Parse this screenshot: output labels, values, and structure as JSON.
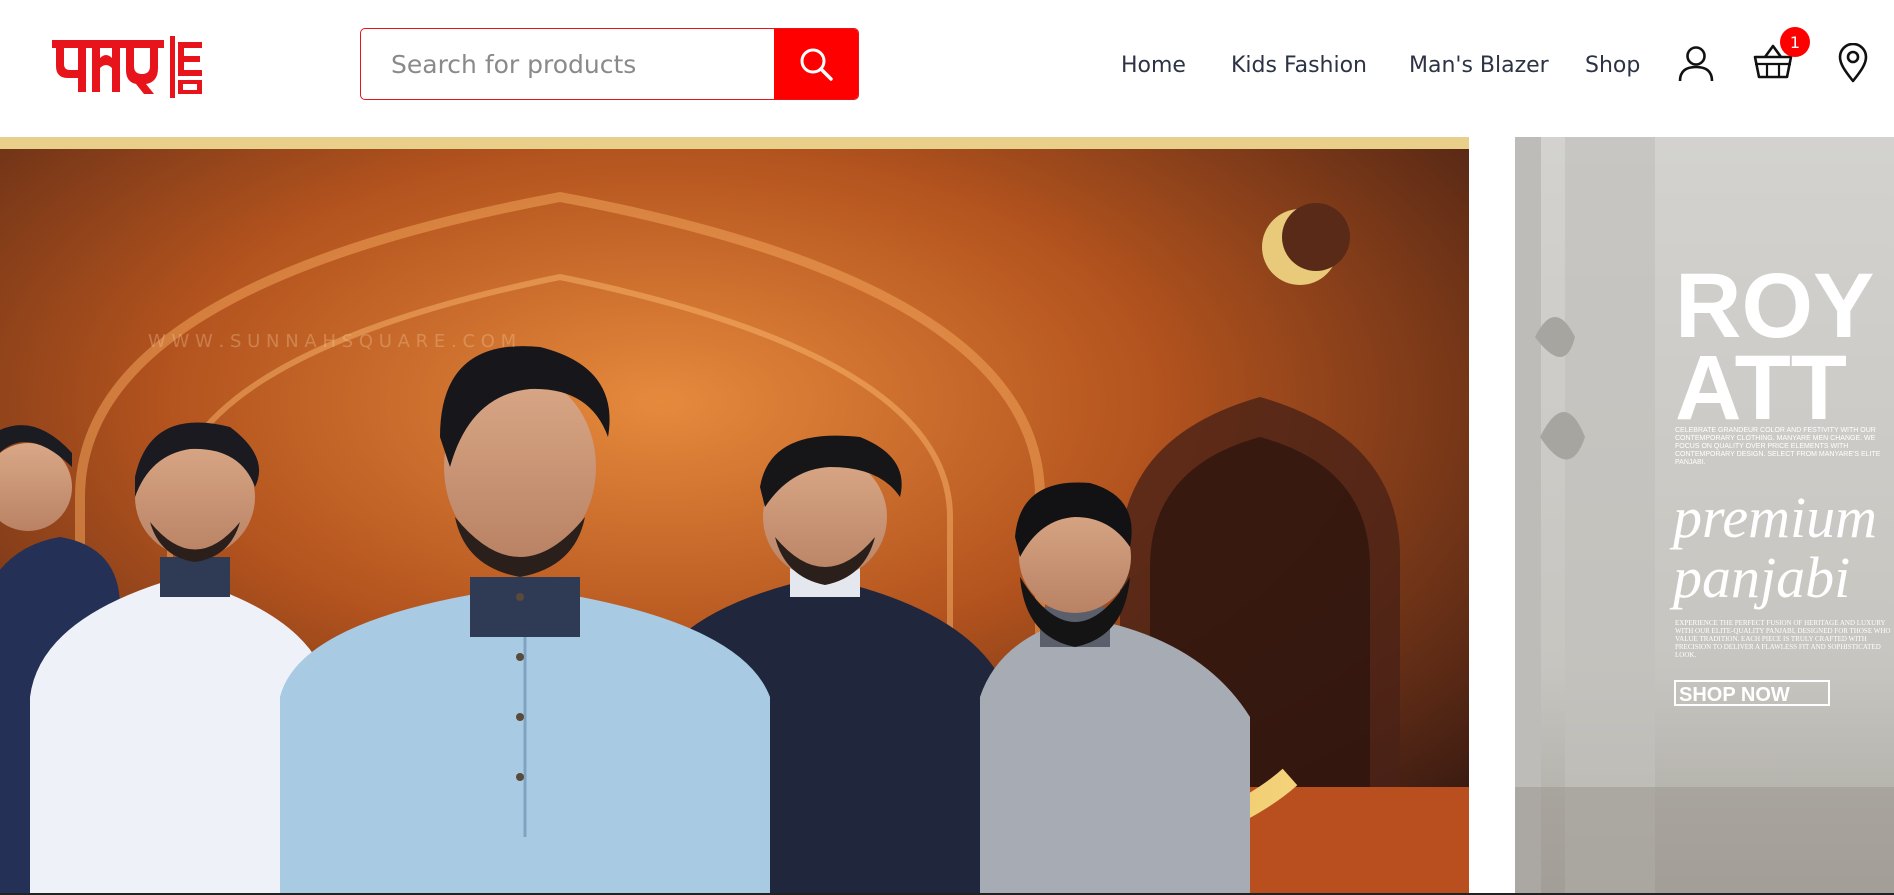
{
  "header": {
    "logo_alt": "পণ্য মেলা",
    "search": {
      "placeholder": "Search for products",
      "value": ""
    },
    "nav": [
      {
        "label": "Home"
      },
      {
        "label": "Kids Fashion"
      },
      {
        "label": "Man's Blazer"
      },
      {
        "label": "Shop"
      }
    ],
    "icons": [
      "user-icon",
      "basket-icon",
      "location-pin-icon",
      "search-icon"
    ],
    "cart_count": "1",
    "accent_color": "#ff0000"
  },
  "hero": {
    "main_slide": {
      "watermark": "W W W . S U N N A H   S Q U A R E . C O M"
    },
    "next_slide": {
      "headline_1": "ROY",
      "headline_2": "ATT",
      "blurb": "CELEBRATE GRANDEUR COLOR AND FESTIVITY WITH OUR CONTEMPORARY CLOTHING. MANYARE MEN CHANGE. WE FOCUS ON QUALITY OVER PRICE ELEMENTS WITH CONTEMPORARY DESIGN. SELECT FROM MANYARE'S ELITE PANJABI.",
      "script_1": "premium",
      "script_2": "panjabi",
      "small_copy": "EXPERIENCE THE PERFECT FUSION OF HERITAGE AND LUXURY WITH OUR ELITE-QUALITY PANJABI, DESIGNED FOR THOSE WHO VALUE TRADITION. EACH PIECE IS TRULY CRAFTED WITH PRECISION TO DELIVER A FLAWLESS FIT AND SOPHISTICATED LOOK.",
      "cta": "SHOP NOW"
    }
  }
}
